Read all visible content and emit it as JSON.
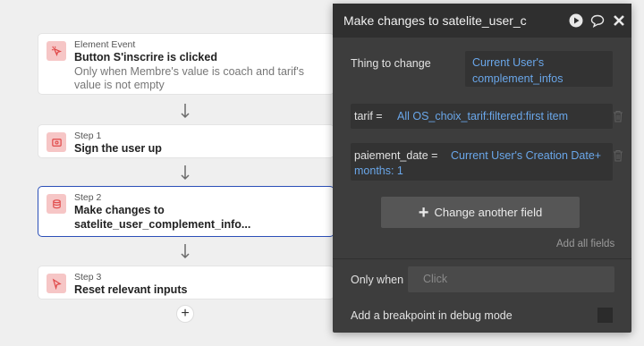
{
  "workflow": {
    "event": {
      "kind": "Element Event",
      "title": "Button S'inscrire is clicked",
      "condition_line1": "Only when Membre's value is coach and tarif's",
      "condition_line2": "value is not empty"
    },
    "steps": [
      {
        "label": "Step 1",
        "title": "Sign the user up"
      },
      {
        "label": "Step 2",
        "title_line1": "Make changes to",
        "title_line2": "satelite_user_complement_info..."
      },
      {
        "label": "Step 3",
        "title": "Reset relevant inputs"
      }
    ],
    "add_step": "+"
  },
  "panel": {
    "title": "Make changes to satelite_user_c",
    "thing_to_change_label": "Thing to change",
    "thing_value_line1": "Current User's",
    "thing_value_line2": "complement_infos",
    "fields": [
      {
        "name": "tarif =",
        "value": "All OS_choix_tarif:filtered:first item"
      },
      {
        "name": "paiement_date =",
        "value_line1": "Current User's Creation Date+",
        "value_line2": "months: 1"
      }
    ],
    "change_button": "Change another field",
    "change_button_icon": "+",
    "add_all_fields": "Add all fields",
    "only_when_label": "Only when",
    "only_when_placeholder": "Click",
    "breakpoint_label": "Add a breakpoint in debug mode"
  },
  "colors": {
    "accent_blue": "#6aa7ea",
    "selected_border": "#2b4fb8",
    "badge_bg": "#f6c6c6",
    "icon_red": "#e04848"
  }
}
